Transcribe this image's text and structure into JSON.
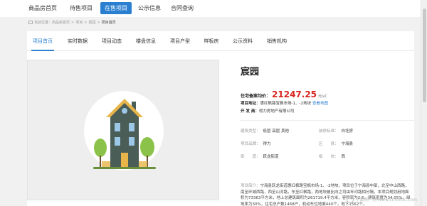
{
  "topnav": {
    "items": [
      {
        "label": "商品房首页"
      },
      {
        "label": "待售项目"
      },
      {
        "label": "在售项目"
      },
      {
        "label": "公示信息"
      },
      {
        "label": "合同查询"
      }
    ],
    "active_index": 2,
    "active_color": "#2b7fd0"
  },
  "breadcrumb": {
    "items": [
      "当前位置：",
      "商品房首页",
      "项目",
      "宸园",
      "项目首页"
    ]
  },
  "tabs": {
    "items": [
      {
        "label": "项目首页"
      },
      {
        "label": "实时数据"
      },
      {
        "label": "项目动态"
      },
      {
        "label": "楼盘信息"
      },
      {
        "label": "项目户型"
      },
      {
        "label": "样板房"
      },
      {
        "label": "公示资料"
      },
      {
        "label": "销售机构"
      }
    ],
    "active_index": 0
  },
  "project": {
    "name": "宸园",
    "price_label": "住宅备案均价：",
    "price_value": "21247.25",
    "price_unit": "元/㎡",
    "price_color": "#d8241e",
    "location_label": "项目地址：",
    "location_value": "惠红枫路宝枫市场-1、-2地块",
    "map_link": "查看地图",
    "developer_label": "开 发 商：",
    "developer_value": "得力房地产有限公司",
    "arch_type_label": "建筑类型：",
    "arch_type_value": "低层 高层 其他",
    "decoration_label": "装修标准：",
    "decoration_value": "白坯房",
    "brand_label": "项目品牌：",
    "brand_value": "得力",
    "district_label": "区　　县：",
    "district_value": "宁海县",
    "street_label": "街　　道：",
    "street_value": "跃龙街道",
    "area_label": "板　　块：",
    "area_value": "西",
    "desc_label": "项目简介：",
    "desc_value": "宁海县跃龙街道惠红枫路宝枫市场-1、-2地块，项目位于宁海县中部，北至中山西路，南至环城西路，西至山河路，东至红枫路，两地块被比向之司由年河路相分隔，本项目规划用地面积为73363平方米，地上总建筑面积为261719.4平方米，容积率为2.6，建筑密度为34.05%，绿地率为30%，住宅总户数1468户，机动车位地面440个，地下1562个。"
  },
  "watermark": {
    "text": "宁波房产网 www.cnnbfdc.com"
  },
  "illustration": {
    "house_color": "#4a5d57",
    "roof_color": "#e7b54a",
    "tree_color": "#8bc34a",
    "window_color": "#9dc7e6",
    "circle_color": "#ffffff"
  }
}
